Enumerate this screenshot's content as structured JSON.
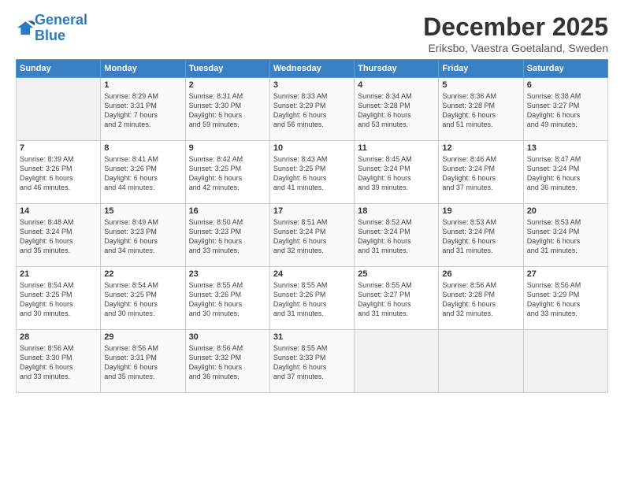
{
  "logo": {
    "line1": "General",
    "line2": "Blue"
  },
  "title": "December 2025",
  "location": "Eriksbo, Vaestra Goetaland, Sweden",
  "weekdays": [
    "Sunday",
    "Monday",
    "Tuesday",
    "Wednesday",
    "Thursday",
    "Friday",
    "Saturday"
  ],
  "weeks": [
    [
      {
        "day": "",
        "info": ""
      },
      {
        "day": "1",
        "info": "Sunrise: 8:29 AM\nSunset: 3:31 PM\nDaylight: 7 hours\nand 2 minutes."
      },
      {
        "day": "2",
        "info": "Sunrise: 8:31 AM\nSunset: 3:30 PM\nDaylight: 6 hours\nand 59 minutes."
      },
      {
        "day": "3",
        "info": "Sunrise: 8:33 AM\nSunset: 3:29 PM\nDaylight: 6 hours\nand 56 minutes."
      },
      {
        "day": "4",
        "info": "Sunrise: 8:34 AM\nSunset: 3:28 PM\nDaylight: 6 hours\nand 53 minutes."
      },
      {
        "day": "5",
        "info": "Sunrise: 8:36 AM\nSunset: 3:28 PM\nDaylight: 6 hours\nand 51 minutes."
      },
      {
        "day": "6",
        "info": "Sunrise: 8:38 AM\nSunset: 3:27 PM\nDaylight: 6 hours\nand 49 minutes."
      }
    ],
    [
      {
        "day": "7",
        "info": "Sunrise: 8:39 AM\nSunset: 3:26 PM\nDaylight: 6 hours\nand 46 minutes."
      },
      {
        "day": "8",
        "info": "Sunrise: 8:41 AM\nSunset: 3:26 PM\nDaylight: 6 hours\nand 44 minutes."
      },
      {
        "day": "9",
        "info": "Sunrise: 8:42 AM\nSunset: 3:25 PM\nDaylight: 6 hours\nand 42 minutes."
      },
      {
        "day": "10",
        "info": "Sunrise: 8:43 AM\nSunset: 3:25 PM\nDaylight: 6 hours\nand 41 minutes."
      },
      {
        "day": "11",
        "info": "Sunrise: 8:45 AM\nSunset: 3:24 PM\nDaylight: 6 hours\nand 39 minutes."
      },
      {
        "day": "12",
        "info": "Sunrise: 8:46 AM\nSunset: 3:24 PM\nDaylight: 6 hours\nand 37 minutes."
      },
      {
        "day": "13",
        "info": "Sunrise: 8:47 AM\nSunset: 3:24 PM\nDaylight: 6 hours\nand 36 minutes."
      }
    ],
    [
      {
        "day": "14",
        "info": "Sunrise: 8:48 AM\nSunset: 3:24 PM\nDaylight: 6 hours\nand 35 minutes."
      },
      {
        "day": "15",
        "info": "Sunrise: 8:49 AM\nSunset: 3:23 PM\nDaylight: 6 hours\nand 34 minutes."
      },
      {
        "day": "16",
        "info": "Sunrise: 8:50 AM\nSunset: 3:23 PM\nDaylight: 6 hours\nand 33 minutes."
      },
      {
        "day": "17",
        "info": "Sunrise: 8:51 AM\nSunset: 3:24 PM\nDaylight: 6 hours\nand 32 minutes."
      },
      {
        "day": "18",
        "info": "Sunrise: 8:52 AM\nSunset: 3:24 PM\nDaylight: 6 hours\nand 31 minutes."
      },
      {
        "day": "19",
        "info": "Sunrise: 8:53 AM\nSunset: 3:24 PM\nDaylight: 6 hours\nand 31 minutes."
      },
      {
        "day": "20",
        "info": "Sunrise: 8:53 AM\nSunset: 3:24 PM\nDaylight: 6 hours\nand 31 minutes."
      }
    ],
    [
      {
        "day": "21",
        "info": "Sunrise: 8:54 AM\nSunset: 3:25 PM\nDaylight: 6 hours\nand 30 minutes."
      },
      {
        "day": "22",
        "info": "Sunrise: 8:54 AM\nSunset: 3:25 PM\nDaylight: 6 hours\nand 30 minutes."
      },
      {
        "day": "23",
        "info": "Sunrise: 8:55 AM\nSunset: 3:26 PM\nDaylight: 6 hours\nand 30 minutes."
      },
      {
        "day": "24",
        "info": "Sunrise: 8:55 AM\nSunset: 3:26 PM\nDaylight: 6 hours\nand 31 minutes."
      },
      {
        "day": "25",
        "info": "Sunrise: 8:55 AM\nSunset: 3:27 PM\nDaylight: 6 hours\nand 31 minutes."
      },
      {
        "day": "26",
        "info": "Sunrise: 8:56 AM\nSunset: 3:28 PM\nDaylight: 6 hours\nand 32 minutes."
      },
      {
        "day": "27",
        "info": "Sunrise: 8:56 AM\nSunset: 3:29 PM\nDaylight: 6 hours\nand 33 minutes."
      }
    ],
    [
      {
        "day": "28",
        "info": "Sunrise: 8:56 AM\nSunset: 3:30 PM\nDaylight: 6 hours\nand 33 minutes."
      },
      {
        "day": "29",
        "info": "Sunrise: 8:56 AM\nSunset: 3:31 PM\nDaylight: 6 hours\nand 35 minutes."
      },
      {
        "day": "30",
        "info": "Sunrise: 8:56 AM\nSunset: 3:32 PM\nDaylight: 6 hours\nand 36 minutes."
      },
      {
        "day": "31",
        "info": "Sunrise: 8:55 AM\nSunset: 3:33 PM\nDaylight: 6 hours\nand 37 minutes."
      },
      {
        "day": "",
        "info": ""
      },
      {
        "day": "",
        "info": ""
      },
      {
        "day": "",
        "info": ""
      }
    ]
  ]
}
